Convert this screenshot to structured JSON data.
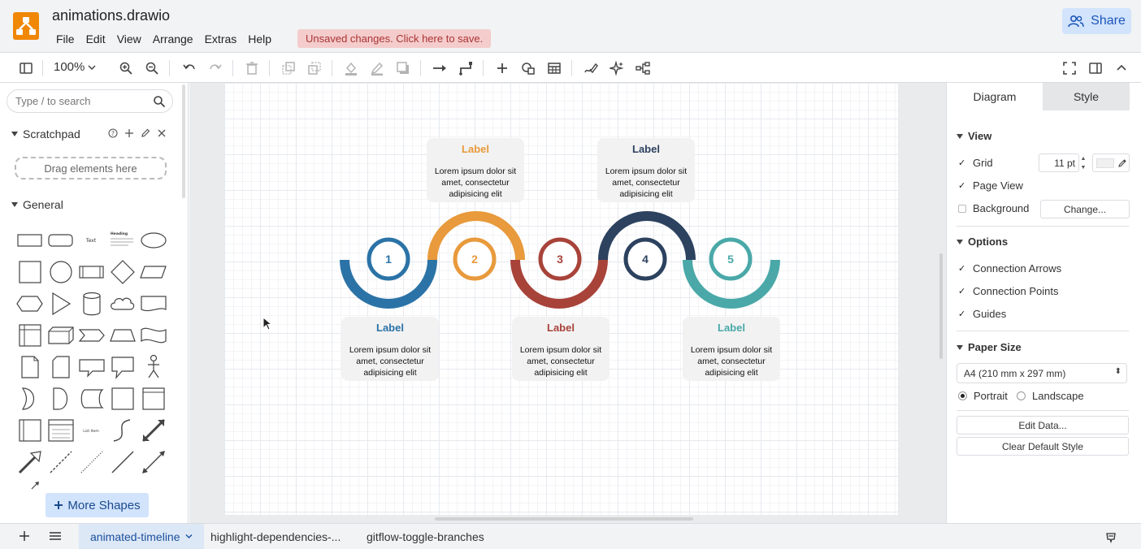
{
  "header": {
    "doc_title": "animations.drawio",
    "menu": [
      "File",
      "Edit",
      "View",
      "Arrange",
      "Extras",
      "Help"
    ],
    "unsaved_notice": "Unsaved changes. Click here to save.",
    "share_label": "Share"
  },
  "toolbar": {
    "zoom": "100%"
  },
  "sidebar": {
    "search_placeholder": "Type / to search",
    "scratchpad_title": "Scratchpad",
    "drop_hint": "Drag elements here",
    "general_title": "General",
    "shape_text_label": "Text",
    "shape_heading_label": "Heading",
    "shape_listitem_label": "List Item",
    "more_shapes_label": "More Shapes"
  },
  "diagram": {
    "steps": [
      {
        "number": "1",
        "color": "#2b73a7",
        "card_title": "Label",
        "card_text": "Lorem ipsum dolor sit amet, consectetur adipisicing elit"
      },
      {
        "number": "2",
        "color": "#e89a3c",
        "card_title": "Label",
        "card_text": "Lorem ipsum dolor sit amet, consectetur adipisicing elit"
      },
      {
        "number": "3",
        "color": "#a8433a",
        "card_title": "Label",
        "card_text": "Lorem ipsum dolor sit amet, consectetur adipisicing elit"
      },
      {
        "number": "4",
        "color": "#2c425f",
        "card_title": "Label",
        "card_text": "Lorem ipsum dolor sit amet, consectetur adipisicing elit"
      },
      {
        "number": "5",
        "color": "#4aa8a8",
        "card_title": "Label",
        "card_text": "Lorem ipsum dolor sit amet, consectetur adipisicing elit"
      }
    ]
  },
  "format_panel": {
    "tabs": [
      "Diagram",
      "Style"
    ],
    "view_title": "View",
    "grid_label": "Grid",
    "grid_size": "11 pt",
    "page_view_label": "Page View",
    "background_label": "Background",
    "change_label": "Change...",
    "options_title": "Options",
    "connection_arrows_label": "Connection Arrows",
    "connection_points_label": "Connection Points",
    "guides_label": "Guides",
    "paper_size_title": "Paper Size",
    "paper_size_value": "A4 (210 mm x 297 mm)",
    "portrait_label": "Portrait",
    "landscape_label": "Landscape",
    "edit_data_label": "Edit Data...",
    "clear_default_style_label": "Clear Default Style"
  },
  "pages": {
    "tabs": [
      "animated-timeline",
      "highlight-dependencies-...",
      "gitflow-toggle-branches"
    ]
  }
}
